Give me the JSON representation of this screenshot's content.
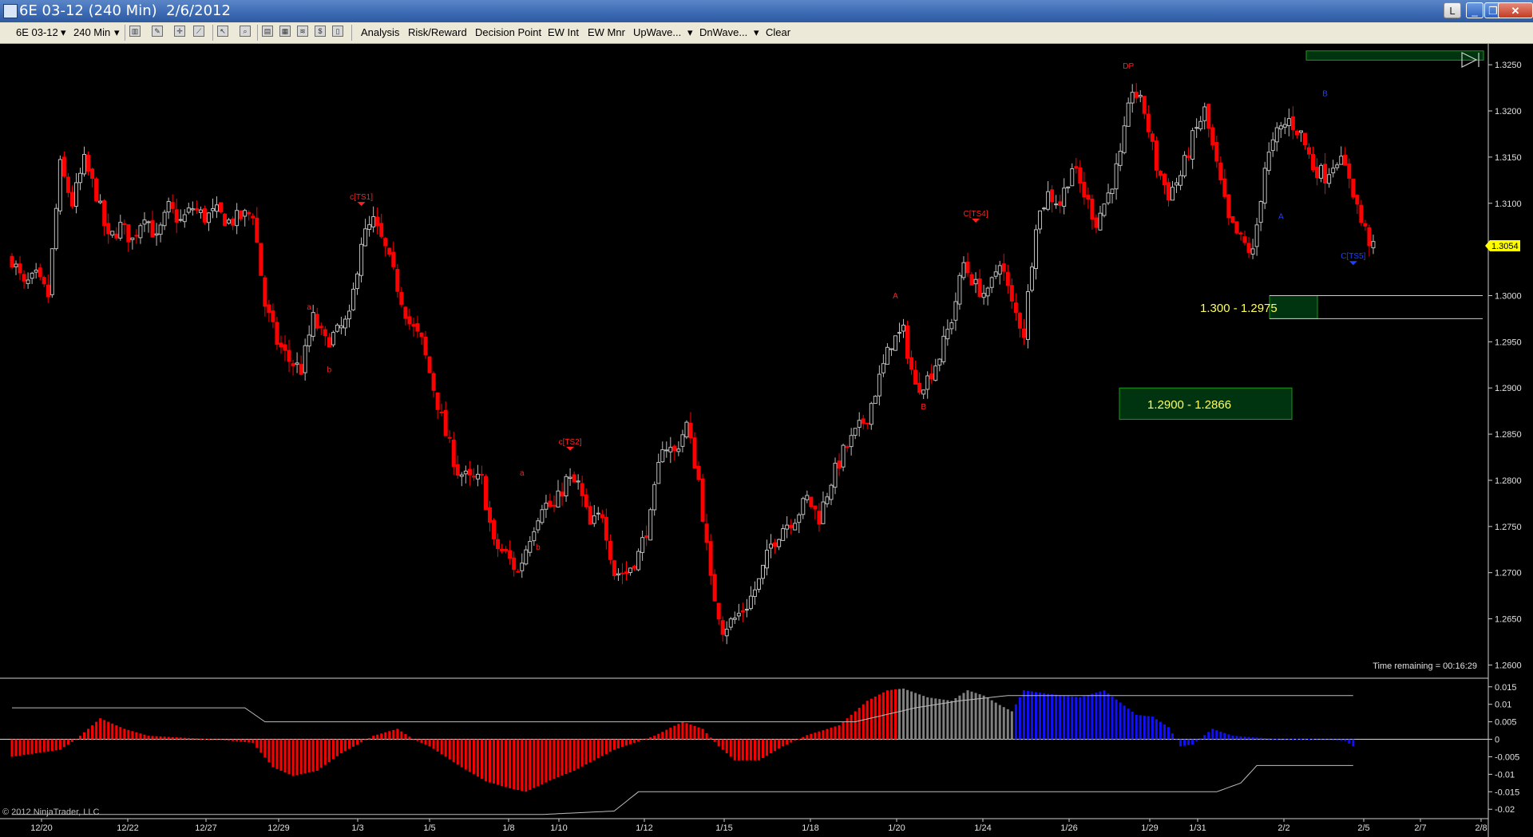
{
  "window": {
    "title": "6E 03-12 (240 Min)  2/6/2012",
    "buttons": {
      "l": "L",
      "minimize": "_",
      "restore": "❐",
      "close": "✕"
    }
  },
  "toolbar": {
    "instrument": "6E 03-12",
    "interval": "240 Min",
    "items": [
      "Analysis",
      "Risk/Reward",
      "Decision Point",
      "EW Int",
      "EW Mnr",
      "UpWave...",
      "DnWave...",
      "Clear"
    ]
  },
  "colors": {
    "up_candle": "#bdbdbd",
    "down_candle": "#ff0000",
    "background": "#000000",
    "zone_fill": "#00330f",
    "zone_border": "#1a9c1a",
    "zone_text": "#ffff5a",
    "hist_red": "#ff0000",
    "hist_gray": "#808080",
    "hist_blue": "#1010ff",
    "last_price_bg": "#ffff00"
  },
  "chart_data": [
    {
      "type": "candlestick",
      "instrument": "6E 03-12",
      "interval": "240 Min",
      "x_labels": [
        "12/20",
        "12/22",
        "12/27",
        "12/29",
        "1/3",
        "1/5",
        "1/8",
        "1/10",
        "1/12",
        "1/15",
        "1/18",
        "1/20",
        "1/24",
        "1/26",
        "1/29",
        "1/31",
        "2/2",
        "2/5",
        "2/7",
        "2/8"
      ],
      "y_ticks": [
        "1.3250",
        "1.3200",
        "1.3150",
        "1.3100",
        "1.3054",
        "1.3000",
        "1.2950",
        "1.2900",
        "1.2850",
        "1.2800",
        "1.2750",
        "1.2700",
        "1.2650",
        "1.2600"
      ],
      "ylim": [
        1.259,
        1.327
      ],
      "last_price": "1.3054",
      "time_remaining": "Time remaining = 00:16:29",
      "copyright": "© 2012 NinjaTrader, LLC",
      "zones": [
        {
          "label": "1.300 - 1.2975",
          "top": 1.3,
          "bottom": 1.2975
        },
        {
          "label": "1.2900 - 1.2866",
          "top": 1.29,
          "bottom": 1.2866
        },
        {
          "label": "",
          "top": 1.3265,
          "bottom": 1.3255
        }
      ],
      "markers": [
        {
          "text": "c[TS1]",
          "bar": 87,
          "price": 1.3104,
          "color": "#ff2020"
        },
        {
          "text": "c[TS2]",
          "bar": 139,
          "price": 1.2839,
          "color": "#ff2020"
        },
        {
          "text": "C[TS4]",
          "bar": 240,
          "price": 1.3086,
          "color": "#ff2020"
        },
        {
          "text": "DP",
          "bar": 278,
          "price": 1.3246,
          "color": "#ff2020"
        },
        {
          "text": "C[TS5]",
          "bar": 334,
          "price": 1.304,
          "color": "#2040ff"
        },
        {
          "text": "a",
          "bar": 74,
          "price": 1.2985,
          "color": "#ff2020"
        },
        {
          "text": "b",
          "bar": 79,
          "price": 1.2917,
          "color": "#ff2020"
        },
        {
          "text": "a",
          "bar": 127,
          "price": 1.2805,
          "color": "#ff2020"
        },
        {
          "text": "b",
          "bar": 131,
          "price": 1.2725,
          "color": "#ff2020"
        },
        {
          "text": "A",
          "bar": 220,
          "price": 1.2997,
          "color": "#ff2020"
        },
        {
          "text": "B",
          "bar": 227,
          "price": 1.2877,
          "color": "#ff2020"
        },
        {
          "text": "A",
          "bar": 316,
          "price": 1.3083,
          "color": "#2040ff"
        },
        {
          "text": "B",
          "bar": 327,
          "price": 1.3216,
          "color": "#2040ff"
        }
      ],
      "path": [
        [
          0,
          1.304
        ],
        [
          3,
          1.301
        ],
        [
          6,
          1.302
        ],
        [
          9,
          1.3
        ],
        [
          12,
          1.314
        ],
        [
          15,
          1.31
        ],
        [
          18,
          1.3145
        ],
        [
          21,
          1.311
        ],
        [
          24,
          1.306
        ],
        [
          27,
          1.3075
        ],
        [
          30,
          1.306
        ],
        [
          33,
          1.309
        ],
        [
          36,
          1.306
        ],
        [
          39,
          1.3095
        ],
        [
          42,
          1.308
        ],
        [
          45,
          1.3095
        ],
        [
          48,
          1.3085
        ],
        [
          51,
          1.309
        ],
        [
          54,
          1.308
        ],
        [
          57,
          1.3085
        ],
        [
          60,
          1.309
        ],
        [
          63,
          1.299
        ],
        [
          66,
          1.295
        ],
        [
          69,
          1.293
        ],
        [
          72,
          1.292
        ],
        [
          75,
          1.2975
        ],
        [
          78,
          1.295
        ],
        [
          81,
          1.296
        ],
        [
          84,
          1.2975
        ],
        [
          87,
          1.306
        ],
        [
          90,
          1.308
        ],
        [
          93,
          1.305
        ],
        [
          96,
          1.301
        ],
        [
          99,
          1.297
        ],
        [
          102,
          1.295
        ],
        [
          105,
          1.29
        ],
        [
          108,
          1.285
        ],
        [
          111,
          1.281
        ],
        [
          114,
          1.28
        ],
        [
          117,
          1.28
        ],
        [
          120,
          1.273
        ],
        [
          123,
          1.272
        ],
        [
          126,
          1.27
        ],
        [
          129,
          1.274
        ],
        [
          132,
          1.2775
        ],
        [
          135,
          1.277
        ],
        [
          138,
          1.28
        ],
        [
          141,
          1.2795
        ],
        [
          144,
          1.275
        ],
        [
          147,
          1.2765
        ],
        [
          150,
          1.27
        ],
        [
          153,
          1.27
        ],
        [
          156,
          1.272
        ],
        [
          159,
          1.276
        ],
        [
          162,
          1.284
        ],
        [
          165,
          1.283
        ],
        [
          168,
          1.286
        ],
        [
          171,
          1.28
        ],
        [
          174,
          1.269
        ],
        [
          177,
          1.264
        ],
        [
          180,
          1.265
        ],
        [
          183,
          1.2665
        ],
        [
          186,
          1.269
        ],
        [
          189,
          1.273
        ],
        [
          192,
          1.275
        ],
        [
          195,
          1.276
        ],
        [
          198,
          1.278
        ],
        [
          201,
          1.276
        ],
        [
          204,
          1.28
        ],
        [
          207,
          1.283
        ],
        [
          210,
          1.285
        ],
        [
          213,
          1.287
        ],
        [
          216,
          1.291
        ],
        [
          219,
          1.295
        ],
        [
          222,
          1.296
        ],
        [
          225,
          1.29
        ],
        [
          228,
          1.291
        ],
        [
          231,
          1.2935
        ],
        [
          234,
          1.2975
        ],
        [
          237,
          1.3035
        ],
        [
          240,
          1.301
        ],
        [
          243,
          1.3
        ],
        [
          246,
          1.304
        ],
        [
          249,
          1.299
        ],
        [
          252,
          1.296
        ],
        [
          255,
          1.308
        ],
        [
          258,
          1.311
        ],
        [
          261,
          1.31
        ],
        [
          264,
          1.314
        ],
        [
          267,
          1.311
        ],
        [
          270,
          1.308
        ],
        [
          273,
          1.311
        ],
        [
          276,
          1.315
        ],
        [
          279,
          1.3225
        ],
        [
          282,
          1.32
        ],
        [
          285,
          1.314
        ],
        [
          288,
          1.311
        ],
        [
          291,
          1.313
        ],
        [
          294,
          1.317
        ],
        [
          297,
          1.32
        ],
        [
          300,
          1.314
        ],
        [
          303,
          1.308
        ],
        [
          306,
          1.306
        ],
        [
          309,
          1.3045
        ],
        [
          312,
          1.314
        ],
        [
          315,
          1.3175
        ],
        [
          318,
          1.319
        ],
        [
          321,
          1.3175
        ],
        [
          324,
          1.314
        ],
        [
          327,
          1.313
        ],
        [
          330,
          1.315
        ],
        [
          333,
          1.313
        ],
        [
          336,
          1.308
        ],
        [
          339,
          1.305
        ]
      ],
      "indicator": {
        "type": "histogram",
        "y_ticks": [
          "0.015",
          "0.01",
          "0.005",
          "0",
          "-0.005",
          "-0.01",
          "-0.015",
          "-0.02"
        ],
        "ylim": [
          -0.022,
          0.017
        ],
        "segments": [
          {
            "from": 0,
            "to": 220,
            "color": "red"
          },
          {
            "from": 221,
            "to": 249,
            "color": "gray"
          },
          {
            "from": 250,
            "to": 339,
            "color": "blue"
          }
        ],
        "path": [
          [
            0,
            -0.005
          ],
          [
            12,
            -0.003
          ],
          [
            16,
            0.0
          ],
          [
            22,
            0.006
          ],
          [
            28,
            0.003
          ],
          [
            34,
            0.001
          ],
          [
            50,
            0.0
          ],
          [
            60,
            -0.001
          ],
          [
            65,
            -0.008
          ],
          [
            70,
            -0.0105
          ],
          [
            76,
            -0.009
          ],
          [
            82,
            -0.004
          ],
          [
            90,
            0.001
          ],
          [
            96,
            0.003
          ],
          [
            100,
            0.0
          ],
          [
            104,
            -0.002
          ],
          [
            112,
            -0.008
          ],
          [
            118,
            -0.012
          ],
          [
            124,
            -0.014
          ],
          [
            128,
            -0.015
          ],
          [
            134,
            -0.0118
          ],
          [
            140,
            -0.009
          ],
          [
            150,
            -0.003
          ],
          [
            160,
            0.001
          ],
          [
            167,
            0.005
          ],
          [
            172,
            0.003
          ],
          [
            176,
            -0.002
          ],
          [
            180,
            -0.006
          ],
          [
            186,
            -0.006
          ],
          [
            192,
            -0.002
          ],
          [
            198,
            0.0012
          ],
          [
            206,
            0.004
          ],
          [
            213,
            0.011
          ],
          [
            218,
            0.014
          ],
          [
            222,
            0.0145
          ],
          [
            228,
            0.012
          ],
          [
            234,
            0.011
          ],
          [
            238,
            0.014
          ],
          [
            242,
            0.0125
          ],
          [
            246,
            0.0098
          ],
          [
            249,
            0.008
          ],
          [
            252,
            0.014
          ],
          [
            258,
            0.013
          ],
          [
            266,
            0.012
          ],
          [
            272,
            0.014
          ],
          [
            280,
            0.007
          ],
          [
            284,
            0.0065
          ],
          [
            288,
            0.0035
          ],
          [
            291,
            -0.002
          ],
          [
            294,
            -0.0015
          ],
          [
            299,
            0.003
          ],
          [
            304,
            0.001
          ],
          [
            316,
            0.0
          ],
          [
            322,
            0.0002
          ],
          [
            332,
            -0.0005
          ],
          [
            334,
            -0.002
          ]
        ],
        "upper_band": [
          [
            0,
            0.009
          ],
          [
            58,
            0.009
          ],
          [
            63,
            0.005
          ],
          [
            210,
            0.005
          ],
          [
            225,
            0.009
          ],
          [
            236,
            0.011
          ],
          [
            248,
            0.0125
          ],
          [
            334,
            0.0125
          ]
        ],
        "lower_band": [
          [
            0,
            -0.0215
          ],
          [
            132,
            -0.0215
          ],
          [
            150,
            -0.0205
          ],
          [
            156,
            -0.015
          ],
          [
            300,
            -0.015
          ],
          [
            306,
            -0.0125
          ],
          [
            310,
            -0.0075
          ],
          [
            334,
            -0.0075
          ]
        ]
      }
    }
  ]
}
